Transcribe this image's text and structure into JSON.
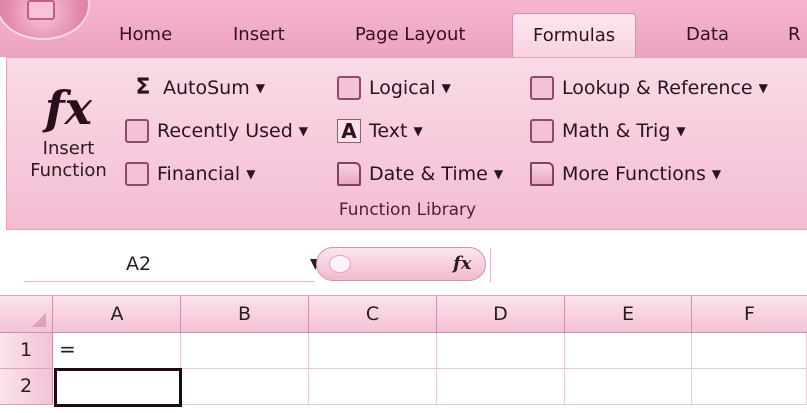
{
  "ribbon_tabs": [
    "Home",
    "Insert",
    "Page Layout",
    "Formulas",
    "Data",
    "R"
  ],
  "active_tab": "Formulas",
  "function_library": {
    "insert_function_line1": "Insert",
    "insert_function_line2": "Function",
    "fx_glyph": "fx",
    "autosum": "AutoSum",
    "recently_used": "Recently Used",
    "financial": "Financial",
    "logical": "Logical",
    "text": "Text",
    "date_time": "Date & Time",
    "lookup_reference": "Lookup & Reference",
    "math_trig": "Math & Trig",
    "more_functions": "More Functions",
    "group_label": "Function Library"
  },
  "formula_bar": {
    "name_box": "A2",
    "fx_glyph": "fx",
    "formula": ""
  },
  "grid": {
    "columns": [
      "A",
      "B",
      "C",
      "D",
      "E",
      "F"
    ],
    "rows": [
      "1",
      "2"
    ],
    "cells": {
      "A1": "=",
      "A2": ""
    },
    "selected_cell": "A2"
  },
  "icons": {
    "autosum": "sigma-icon",
    "recently_used": "star-book-icon",
    "financial": "money-book-icon",
    "logical": "question-book-icon",
    "text": "letter-a-icon",
    "date_time": "clock-book-icon",
    "lookup_reference": "magnifier-book-icon",
    "math_trig": "theta-book-icon",
    "more_functions": "books-icon"
  },
  "theme_colors": {
    "ribbon": "#f6c9db",
    "tab_strip": "#eea2c1",
    "accent": "#d98fb0"
  }
}
